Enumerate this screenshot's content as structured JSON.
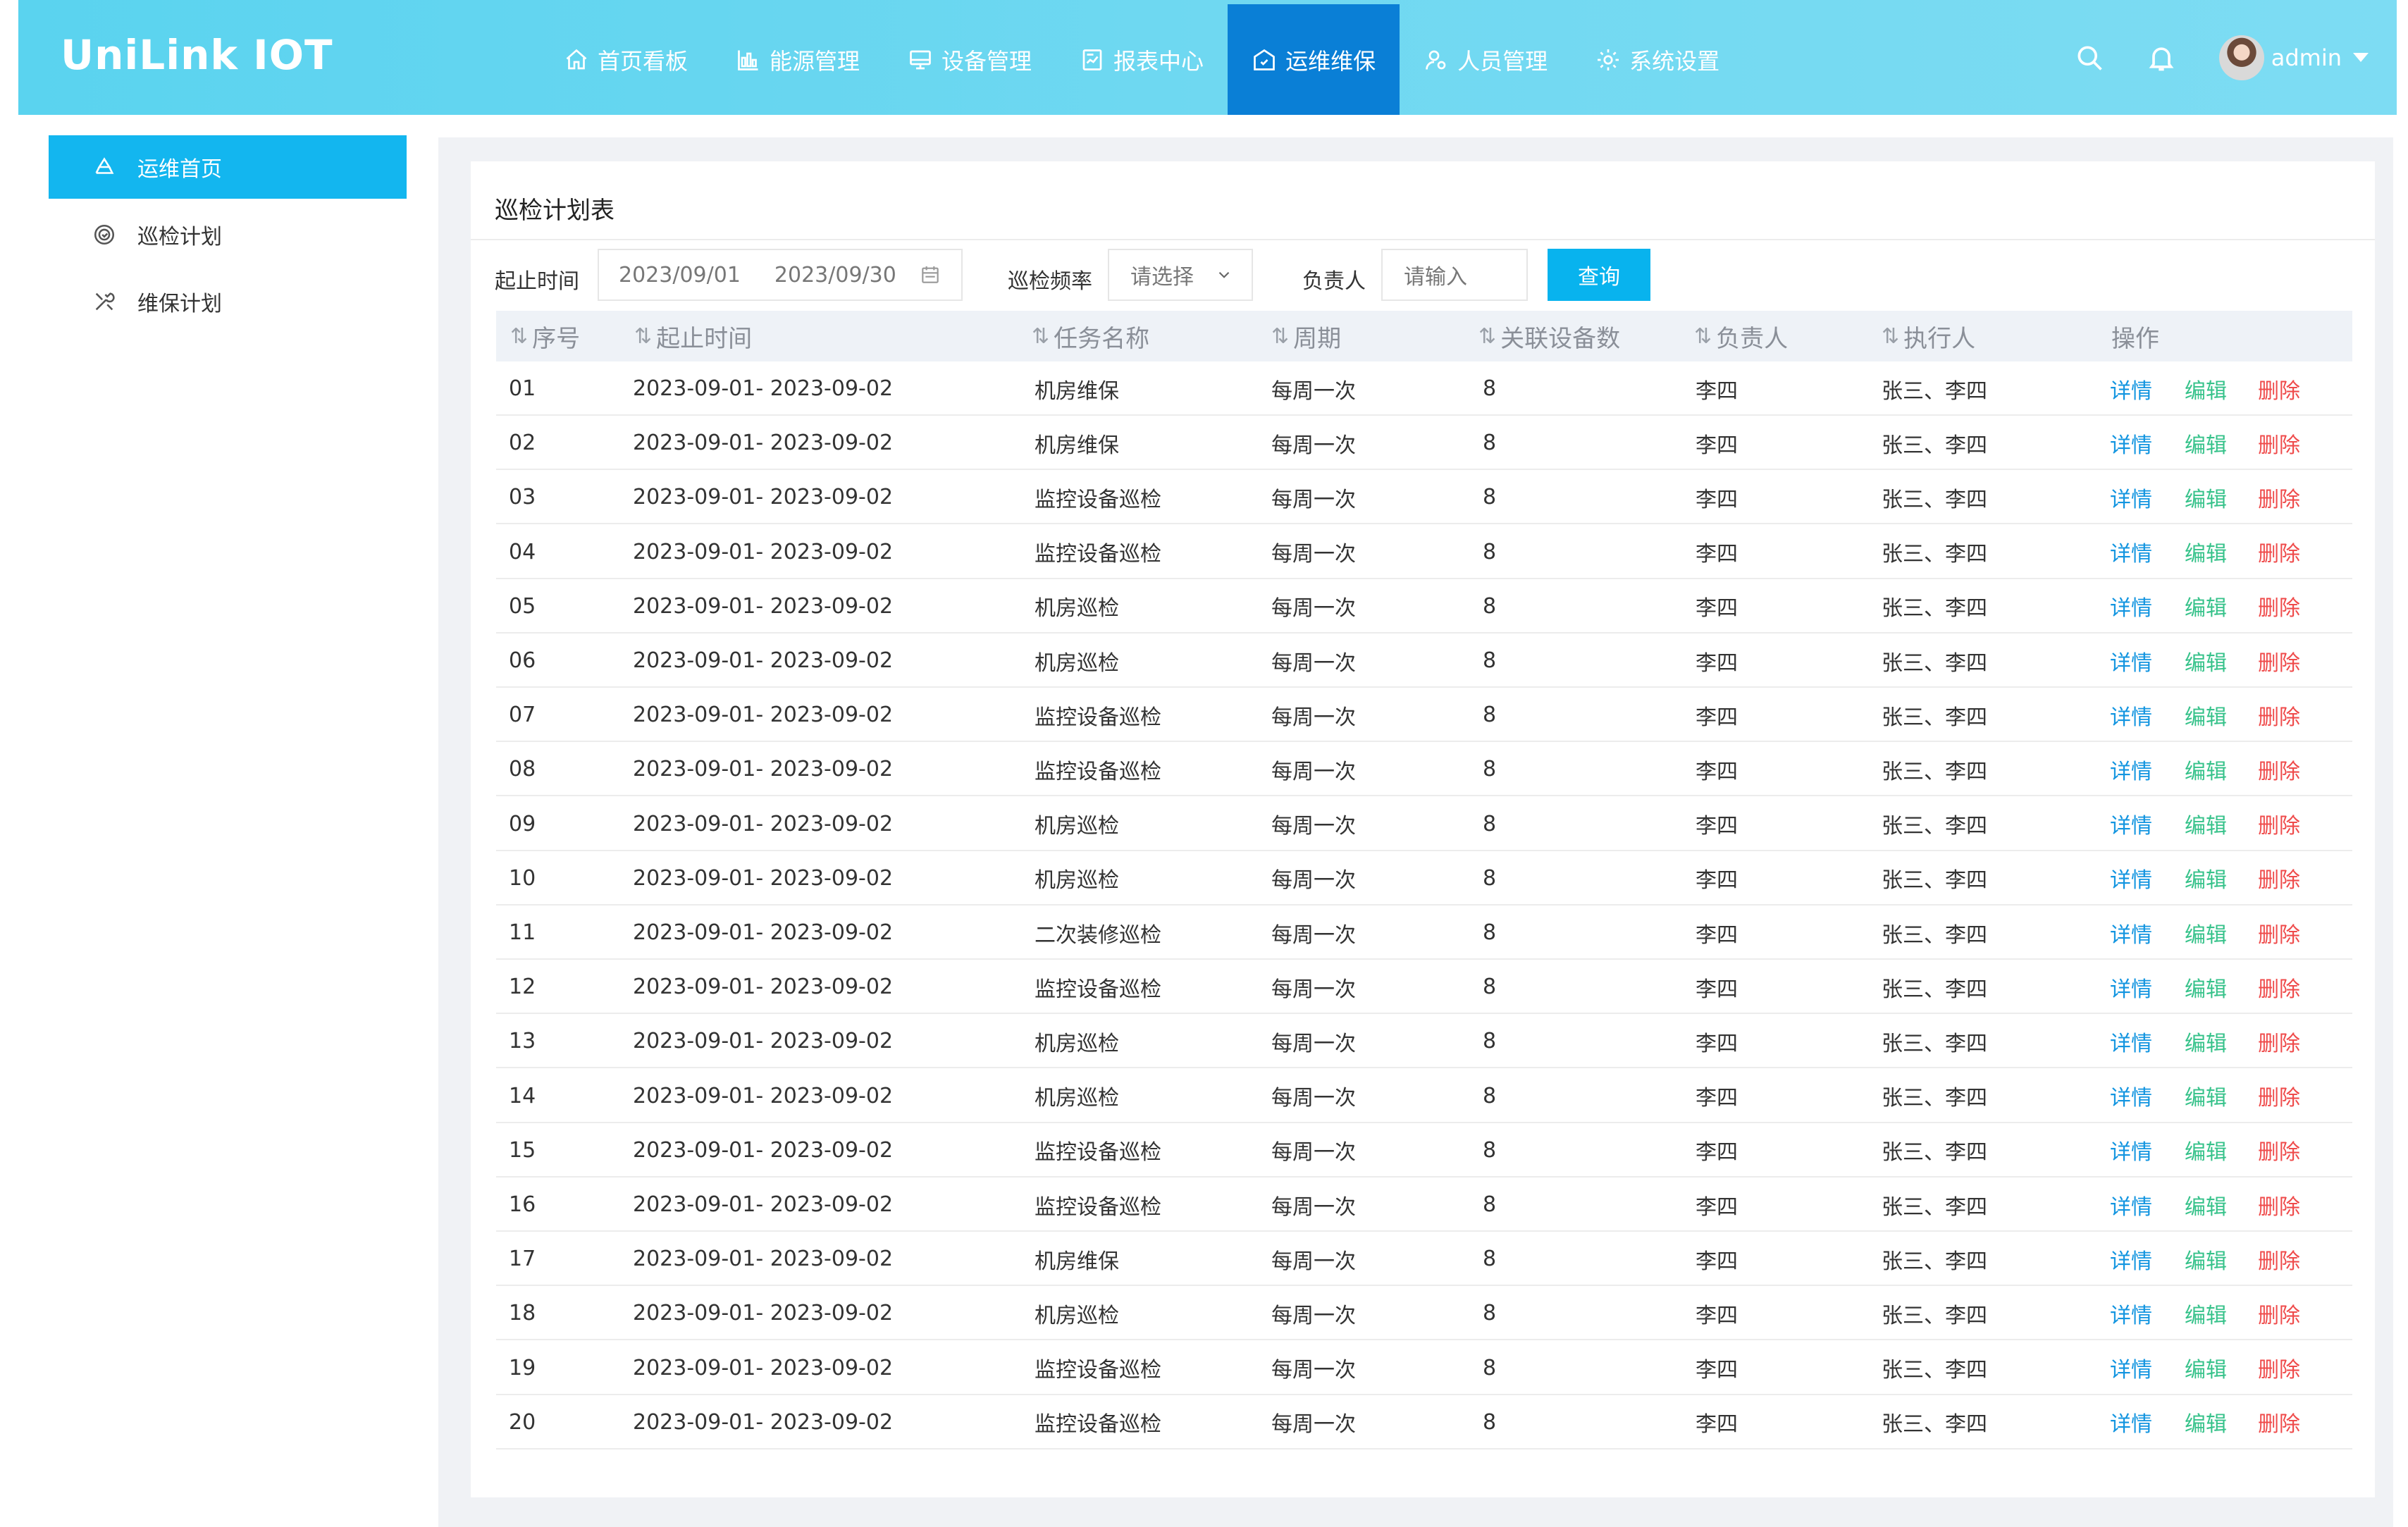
{
  "brand": {
    "logo_text": "UniLink IOT"
  },
  "nav": {
    "items": [
      {
        "label": "首页看板",
        "icon": "home-icon"
      },
      {
        "label": "能源管理",
        "icon": "bar-chart-icon"
      },
      {
        "label": "设备管理",
        "icon": "device-icon"
      },
      {
        "label": "报表中心",
        "icon": "report-icon"
      },
      {
        "label": "运维维保",
        "icon": "maintenance-icon",
        "active": true
      },
      {
        "label": "人员管理",
        "icon": "user-settings-icon"
      },
      {
        "label": "系统设置",
        "icon": "gear-icon"
      }
    ]
  },
  "user": {
    "name": "admin"
  },
  "sidebar": {
    "items": [
      {
        "label": "运维首页",
        "icon": "recycle-icon",
        "active": true
      },
      {
        "label": "巡检计划",
        "icon": "inspection-icon"
      },
      {
        "label": "维保计划",
        "icon": "tools-icon"
      }
    ]
  },
  "card": {
    "title": "巡检计划表"
  },
  "filters": {
    "time_label": "起止时间",
    "start_date": "2023/09/01",
    "end_date": "2023/09/30",
    "freq_label": "巡检频率",
    "freq_placeholder": "请选择",
    "owner_label": "负责人",
    "owner_placeholder": "请输入",
    "query_label": "查询"
  },
  "table": {
    "columns": [
      "序号",
      "起止时间",
      "任务名称",
      "周期",
      "关联设备数",
      "负责人",
      "执行人",
      "操作"
    ],
    "actions": {
      "detail": "详情",
      "edit": "编辑",
      "delete": "删除"
    },
    "rows": [
      [
        "01",
        "2023-09-01- 2023-09-02",
        "机房维保",
        "每周一次",
        "8",
        "李四",
        "张三、李四"
      ],
      [
        "02",
        "2023-09-01- 2023-09-02",
        "机房维保",
        "每周一次",
        "8",
        "李四",
        "张三、李四"
      ],
      [
        "03",
        "2023-09-01- 2023-09-02",
        "监控设备巡检",
        "每周一次",
        "8",
        "李四",
        "张三、李四"
      ],
      [
        "04",
        "2023-09-01- 2023-09-02",
        "监控设备巡检",
        "每周一次",
        "8",
        "李四",
        "张三、李四"
      ],
      [
        "05",
        "2023-09-01- 2023-09-02",
        "机房巡检",
        "每周一次",
        "8",
        "李四",
        "张三、李四"
      ],
      [
        "06",
        "2023-09-01- 2023-09-02",
        "机房巡检",
        "每周一次",
        "8",
        "李四",
        "张三、李四"
      ],
      [
        "07",
        "2023-09-01- 2023-09-02",
        "监控设备巡检",
        "每周一次",
        "8",
        "李四",
        "张三、李四"
      ],
      [
        "08",
        "2023-09-01- 2023-09-02",
        "监控设备巡检",
        "每周一次",
        "8",
        "李四",
        "张三、李四"
      ],
      [
        "09",
        "2023-09-01- 2023-09-02",
        "机房巡检",
        "每周一次",
        "8",
        "李四",
        "张三、李四"
      ],
      [
        "10",
        "2023-09-01- 2023-09-02",
        "机房巡检",
        "每周一次",
        "8",
        "李四",
        "张三、李四"
      ],
      [
        "11",
        "2023-09-01- 2023-09-02",
        "二次装修巡检",
        "每周一次",
        "8",
        "李四",
        "张三、李四"
      ],
      [
        "12",
        "2023-09-01- 2023-09-02",
        "监控设备巡检",
        "每周一次",
        "8",
        "李四",
        "张三、李四"
      ],
      [
        "13",
        "2023-09-01- 2023-09-02",
        "机房巡检",
        "每周一次",
        "8",
        "李四",
        "张三、李四"
      ],
      [
        "14",
        "2023-09-01- 2023-09-02",
        "机房巡检",
        "每周一次",
        "8",
        "李四",
        "张三、李四"
      ],
      [
        "15",
        "2023-09-01- 2023-09-02",
        "监控设备巡检",
        "每周一次",
        "8",
        "李四",
        "张三、李四"
      ],
      [
        "16",
        "2023-09-01- 2023-09-02",
        "监控设备巡检",
        "每周一次",
        "8",
        "李四",
        "张三、李四"
      ],
      [
        "17",
        "2023-09-01- 2023-09-02",
        "机房维保",
        "每周一次",
        "8",
        "李四",
        "张三、李四"
      ],
      [
        "18",
        "2023-09-01- 2023-09-02",
        "机房巡检",
        "每周一次",
        "8",
        "李四",
        "张三、李四"
      ],
      [
        "19",
        "2023-09-01- 2023-09-02",
        "监控设备巡检",
        "每周一次",
        "8",
        "李四",
        "张三、李四"
      ],
      [
        "20",
        "2023-09-01- 2023-09-02",
        "监控设备巡检",
        "每周一次",
        "8",
        "李四",
        "张三、李四"
      ]
    ]
  },
  "colors": {
    "header_gradient_start": "#5ad3ef",
    "nav_active": "#0a7fd6",
    "sidebar_active": "#13b6ef",
    "query_button": "#08b3ee",
    "action_detail": "#1395e0",
    "action_edit": "#36c28a",
    "action_delete": "#ef4b4b"
  }
}
